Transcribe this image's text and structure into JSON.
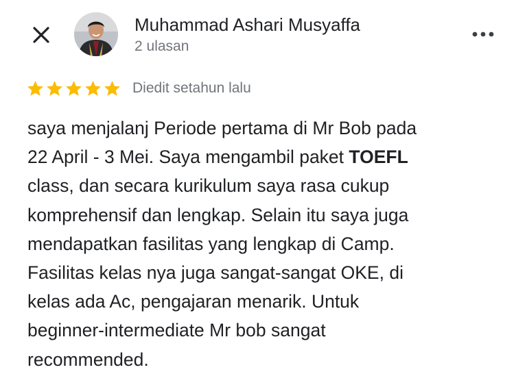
{
  "header": {
    "close_icon": "close-icon",
    "author_name": "Muhammad Ashari Musyaffa",
    "review_count": "2 ulasan",
    "more_icon": "more-horizontal-icon"
  },
  "rating": {
    "stars": 5,
    "max_stars": 5,
    "star_color": "#fbbc04",
    "edited_label": "Diedit setahun lalu"
  },
  "review": {
    "lines": [
      [
        "saya menjalanj Periode pertama di Mr Bob pada"
      ],
      [
        "22 April - 3 Mei. Saya mengambil paket ",
        "TOEFL"
      ],
      [
        "class, dan secara kurikulum saya rasa cukup"
      ],
      [
        "komprehensif dan lengkap. Selain itu saya juga"
      ],
      [
        "mendapatkan fasilitas yang lengkap di Camp."
      ],
      [
        "Fasilitas kelas nya juga sangat-sangat OKE, di"
      ],
      [
        "kelas ada Ac, pengajaran menarik. Untuk"
      ],
      [
        "beginner-intermediate Mr bob sangat"
      ],
      [
        "recommended."
      ]
    ]
  }
}
